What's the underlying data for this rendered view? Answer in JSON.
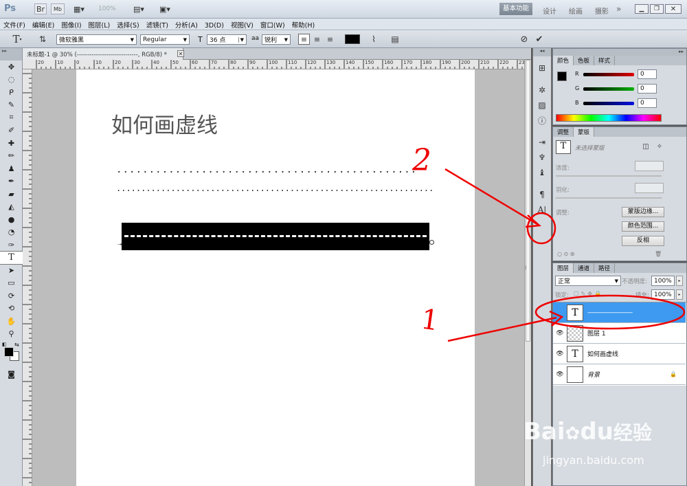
{
  "appbar": {
    "ps_logo": "Ps",
    "zoom": "100%",
    "workspaces": [
      "基本功能",
      "设计",
      "绘画",
      "摄影"
    ],
    "more": "»"
  },
  "menu": [
    "文件(F)",
    "编辑(E)",
    "图像(I)",
    "图层(L)",
    "选择(S)",
    "滤镜(T)",
    "分析(A)",
    "3D(D)",
    "视图(V)",
    "窗口(W)",
    "帮助(H)"
  ],
  "options": {
    "tool_letter": "T",
    "font_family": "微软雅黑",
    "font_style": "Regular",
    "font_size": "36 点",
    "aa_label": "a",
    "aa_value": "锐利",
    "color": "#000000"
  },
  "document": {
    "tab_title": "未标题-1 @ 30% (-----------------------------, RGB/8) *",
    "heading": "如何画虚线",
    "dots_line1": "............................................................................................",
    "dots_line2": "..........................................................................................................",
    "ruler_labels": [
      "20",
      "10",
      "0",
      "10",
      "20",
      "30",
      "40",
      "50",
      "60",
      "70",
      "80",
      "90",
      "100",
      "110",
      "120",
      "130",
      "140",
      "150",
      "160",
      "170",
      "180",
      "190",
      "200",
      "210",
      "220",
      "230"
    ]
  },
  "color_panel": {
    "tabs": [
      "颜色",
      "色板",
      "样式"
    ],
    "channels": [
      {
        "label": "R",
        "value": "0",
        "color": "#e00000"
      },
      {
        "label": "G",
        "value": "0",
        "color": "#00b000"
      },
      {
        "label": "B",
        "value": "0",
        "color": "#0010e0"
      }
    ]
  },
  "adjust_panel": {
    "tabs": [
      "调整",
      "蒙版"
    ],
    "no_mask": "未选择蒙版",
    "density": "浓度:",
    "feather": "羽化:",
    "refine": "调整:",
    "buttons": [
      "蒙版边缘...",
      "颜色范围...",
      "反相"
    ]
  },
  "layers_panel": {
    "tabs": [
      "图层",
      "通道",
      "路径"
    ],
    "blend_mode": "正常",
    "opacity_label": "不透明度:",
    "opacity": "100%",
    "lock_label": "锁定:",
    "fill_label": "填充:",
    "fill": "100%",
    "layers": [
      {
        "name": "-----------------------------",
        "type": "T",
        "selected": true
      },
      {
        "name": "图层 1",
        "type": "checker",
        "selected": false
      },
      {
        "name": "如何画虚线",
        "type": "T",
        "selected": false
      },
      {
        "name": "背景",
        "type": "white",
        "selected": false
      }
    ]
  },
  "annotations": {
    "num1": "1",
    "num2": "2"
  },
  "watermark": {
    "brand_a": "Bai",
    "brand_b": "du",
    "brand_cn": "经验",
    "url": "jingyan.baidu.com"
  }
}
